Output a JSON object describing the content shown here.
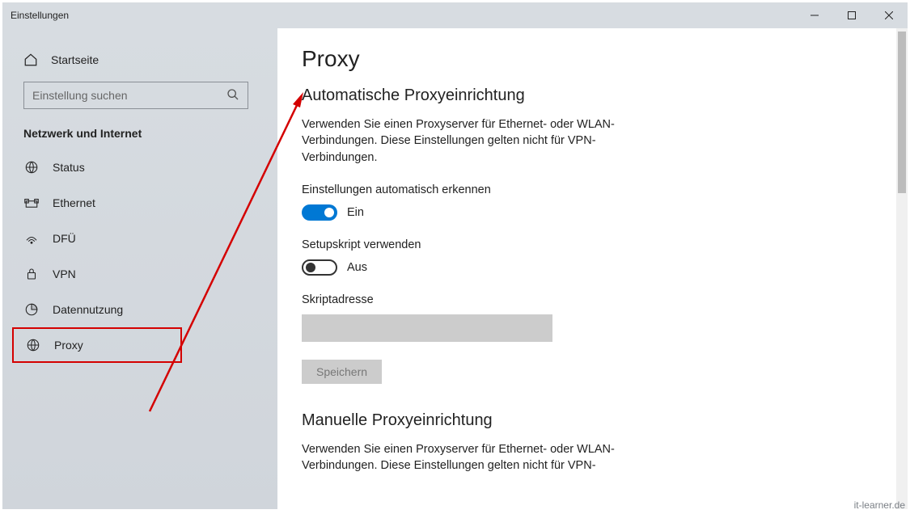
{
  "titlebar": {
    "title": "Einstellungen"
  },
  "sidebar": {
    "home": "Startseite",
    "search_placeholder": "Einstellung suchen",
    "section": "Netzwerk und Internet",
    "items": [
      {
        "label": "Status",
        "icon": "status"
      },
      {
        "label": "Ethernet",
        "icon": "ethernet"
      },
      {
        "label": "DFÜ",
        "icon": "dialup"
      },
      {
        "label": "VPN",
        "icon": "vpn"
      },
      {
        "label": "Datennutzung",
        "icon": "data"
      },
      {
        "label": "Proxy",
        "icon": "globe"
      }
    ]
  },
  "content": {
    "title": "Proxy",
    "auto_section": {
      "heading": "Automatische Proxyeinrichtung",
      "description": "Verwenden Sie einen Proxyserver für Ethernet- oder WLAN-Verbindungen. Diese Einstellungen gelten nicht für VPN-Verbindungen.",
      "detect_label": "Einstellungen automatisch erkennen",
      "detect_state": "Ein",
      "script_label": "Setupskript verwenden",
      "script_state": "Aus",
      "script_addr_label": "Skriptadresse",
      "save": "Speichern"
    },
    "manual_section": {
      "heading": "Manuelle Proxyeinrichtung",
      "description": "Verwenden Sie einen Proxyserver für Ethernet- oder WLAN-Verbindungen. Diese Einstellungen gelten nicht für VPN-"
    }
  },
  "watermark": "it-learner.de"
}
